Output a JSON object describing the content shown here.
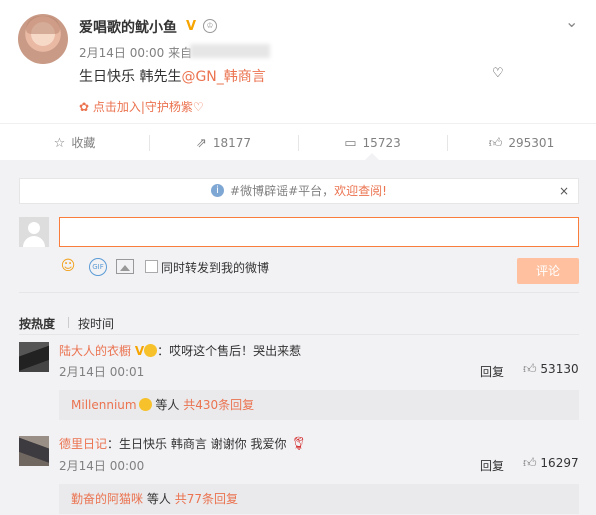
{
  "post": {
    "author": "爱唱歌的鱿小鱼",
    "verified_badge": "V",
    "date": "2月14日 00:00",
    "source_prefix": "来自",
    "text_prefix": "生日快乐 韩先生",
    "mention": "@GN_韩商言",
    "text_suffix": "♡",
    "join_link": "点击加入|守护杨紫♡"
  },
  "actions": [
    {
      "label": "收藏",
      "icon": "star-icon"
    },
    {
      "label": "18177",
      "icon": "share-icon"
    },
    {
      "label": "15723",
      "icon": "comment-icon"
    },
    {
      "label": "295301",
      "icon": "like-icon"
    }
  ],
  "notice": {
    "prefix": "#微博辟谣#平台，",
    "link": "欢迎查阅!",
    "close": "×"
  },
  "composer": {
    "input_value": "",
    "forward_label": "同时转发到我的微博",
    "submit_label": "评论"
  },
  "sort": {
    "by_hot": "按热度",
    "by_time": "按时间"
  },
  "comments": [
    {
      "author": "陆大人的衣橱",
      "text": "：哎呀这个售后！哭出来惹",
      "date": "2月14日 00:01",
      "reply_label": "回复",
      "likes": "53130",
      "reply_author": "Millennium",
      "reply_mid": "等人",
      "reply_count": "共430条回复"
    },
    {
      "author": "德里日记",
      "text": "：生日快乐 韩商言 谢谢你 我爱你",
      "date": "2月14日 00:00",
      "reply_label": "回复",
      "likes": "16297",
      "reply_author": "勤奋的阿猫咪",
      "reply_mid": "等人",
      "reply_count": "共77条回复"
    }
  ]
}
